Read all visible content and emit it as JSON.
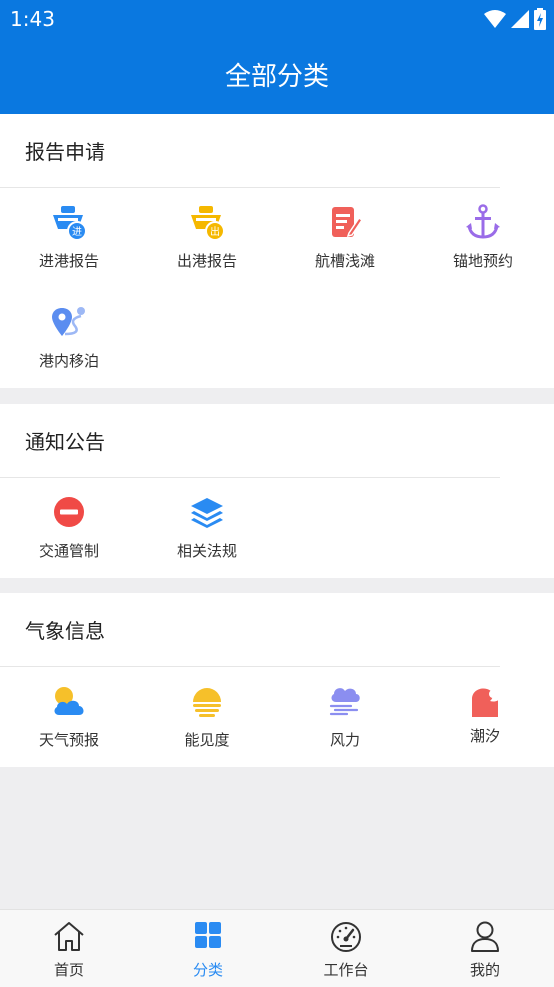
{
  "status_bar": {
    "time": "1:43"
  },
  "header": {
    "title": "全部分类"
  },
  "sections": [
    {
      "title": "报告申请",
      "items": [
        {
          "label": "进港报告",
          "icon": "ship-in-icon",
          "badge": "进"
        },
        {
          "label": "出港报告",
          "icon": "ship-out-icon",
          "badge": "出"
        },
        {
          "label": "航槽浅滩",
          "icon": "document-edit-icon"
        },
        {
          "label": "锚地预约",
          "icon": "anchor-icon"
        },
        {
          "label": "港内移泊",
          "icon": "map-route-icon"
        }
      ]
    },
    {
      "title": "通知公告",
      "items": [
        {
          "label": "交通管制",
          "icon": "no-entry-icon"
        },
        {
          "label": "相关法规",
          "icon": "layers-icon"
        }
      ]
    },
    {
      "title": "气象信息",
      "items": [
        {
          "label": "天气预报",
          "icon": "partly-cloudy-icon"
        },
        {
          "label": "能见度",
          "icon": "sun-haze-icon"
        },
        {
          "label": "风力",
          "icon": "cloud-wind-icon"
        },
        {
          "label": "潮汐",
          "icon": "wave-icon"
        }
      ]
    }
  ],
  "bottom_nav": [
    {
      "label": "首页",
      "icon": "home-icon"
    },
    {
      "label": "分类",
      "icon": "grid-icon",
      "active": true
    },
    {
      "label": "工作台",
      "icon": "dashboard-icon"
    },
    {
      "label": "我的",
      "icon": "user-icon"
    }
  ],
  "colors": {
    "brand": "#0a78e0",
    "active_tab": "#2a8bf2"
  }
}
